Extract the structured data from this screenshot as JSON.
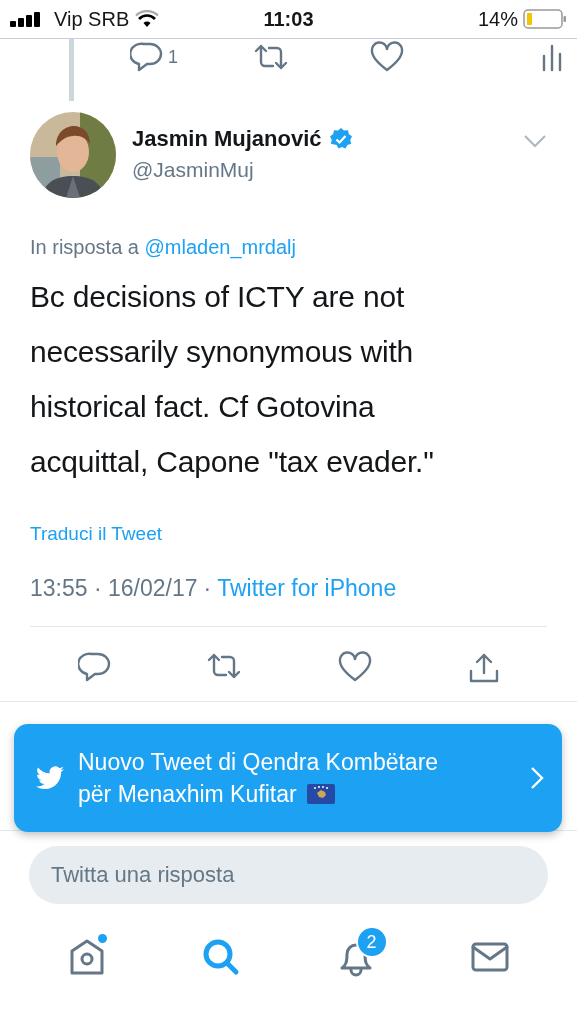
{
  "status_bar": {
    "carrier": "Vip SRB",
    "time": "11:03",
    "battery": "14%"
  },
  "previous_tweet": {
    "reply_count": "1"
  },
  "tweet": {
    "name": "Jasmin Mujanović",
    "verified": true,
    "handle": "@JasminMuj",
    "reply_prefix": "In risposta a",
    "reply_to": "@mladen_mrdalj",
    "text": "Bc decisions of ICTY are not necessarily synonymous with historical fact. Cf Gotovina acquittal, Capone \"tax evader.\"",
    "translate": "Traduci il Tweet",
    "time": "13:55 · 16/02/17",
    "separator": "·",
    "source": "Twitter for iPhone"
  },
  "banner": {
    "line1": "Nuovo Tweet di Qendra Kombëtare",
    "line2": "për Menaxhim Kufitar"
  },
  "reply_field": {
    "placeholder": "Twitta una risposta"
  },
  "tab_bar": [
    {
      "kind": "home",
      "selected": false,
      "new": true
    },
    {
      "kind": "search",
      "selected": true,
      "new": false
    },
    {
      "kind": "notifications",
      "selected": false,
      "new": false,
      "badge": "2"
    },
    {
      "kind": "messages",
      "selected": false,
      "new": false
    }
  ]
}
